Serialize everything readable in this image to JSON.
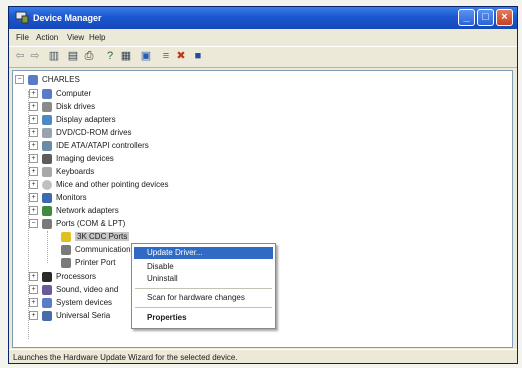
{
  "window": {
    "title": "Device Manager"
  },
  "menu": [
    "File",
    "Action",
    "View",
    "Help"
  ],
  "tree": {
    "root": "CHARLES",
    "categories": [
      "Computer",
      "Disk drives",
      "Display adapters",
      "DVD/CD-ROM drives",
      "IDE ATA/ATAPI controllers",
      "Imaging devices",
      "Keyboards",
      "Mice and other pointing devices",
      "Monitors",
      "Network adapters",
      "Ports (COM & LPT)"
    ],
    "ports_children": [
      "3K CDC Ports",
      "Communications",
      "Printer Port"
    ],
    "after": [
      "Processors",
      "Sound, video and",
      "System devices",
      "Universal Seria"
    ]
  },
  "context_menu": {
    "items": [
      "Update Driver...",
      "Disable",
      "Uninstall",
      "Scan for hardware changes",
      "Properties"
    ]
  },
  "status": "Launches the Hardware Update Wizard for the selected device.",
  "colors": {
    "title_bar": "#1a57d0",
    "highlight": "#316ac5",
    "close_button": "#c9411f"
  }
}
